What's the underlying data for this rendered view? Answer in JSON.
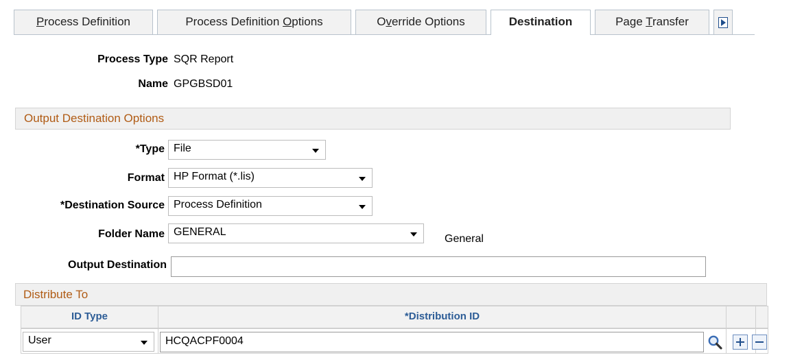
{
  "tabs": [
    {
      "pre": "",
      "u": "P",
      "post": "rocess Definition"
    },
    {
      "pre": "Process Definition ",
      "u": "O",
      "post": "ptions"
    },
    {
      "pre": "O",
      "u": "v",
      "post": "erride Options"
    },
    {
      "pre": "Destination",
      "u": "",
      "post": ""
    },
    {
      "pre": "Page ",
      "u": "T",
      "post": "ransfer"
    }
  ],
  "header": {
    "process_type_label": "Process Type",
    "process_type_value": "SQR Report",
    "name_label": "Name",
    "name_value": "GPGBSD01"
  },
  "output_section": {
    "title": "Output Destination Options",
    "type_label": "*Type",
    "type_value": "File",
    "format_label": "Format",
    "format_value": "HP Format (*.lis)",
    "dest_source_label": "*Destination Source",
    "dest_source_value": "Process Definition",
    "folder_label": "Folder Name",
    "folder_value": "GENERAL",
    "folder_desc": "General",
    "output_dest_label": "Output Destination",
    "output_dest_value": ""
  },
  "distribute": {
    "title": "Distribute To",
    "col_id_type": "ID Type",
    "col_dist_id": "*Distribution ID",
    "rows": [
      {
        "id_type": "User",
        "dist_id": "HCQACPF0004"
      }
    ]
  },
  "icons": {
    "next_tab": "next-tab-icon",
    "lookup": "magnifier-icon",
    "add_row": "plus-icon",
    "delete_row": "minus-icon"
  },
  "colors": {
    "section_title": "#b05b14",
    "grid_header_text": "#2c5c96"
  }
}
